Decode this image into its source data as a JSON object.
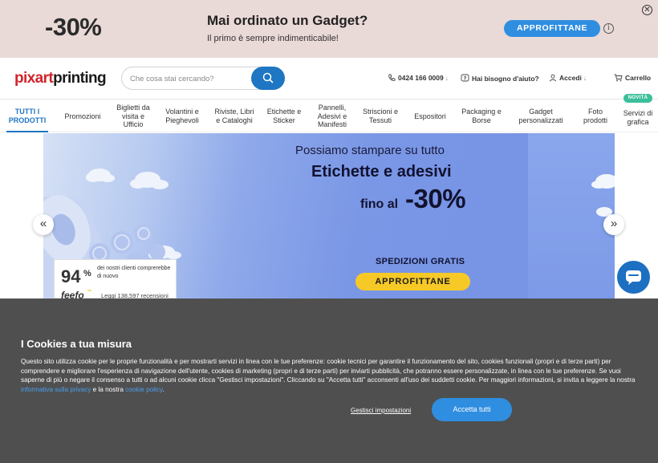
{
  "promo": {
    "discount": "-30%",
    "title": "Mai ordinato un Gadget?",
    "subtitle": "Il primo è sempre indimenticabile!",
    "cta": "APPROFITTANE",
    "info_icon": "info-icon",
    "close_icon": "close-icon"
  },
  "header": {
    "logo_red": "pixart",
    "logo_dark": "printing",
    "search_placeholder": "Che cosa stai cercando?",
    "phone": "0424 166 0009",
    "help": "Hai bisogno d'aiuto?",
    "login": "Accedi",
    "cart": "Carrello"
  },
  "nav": {
    "items": [
      {
        "label": "TUTTI I PRODOTTI"
      },
      {
        "label": "Promozioni"
      },
      {
        "label": "Biglietti da visita e Ufficio"
      },
      {
        "label": "Volantini e Pieghevoli"
      },
      {
        "label": "Riviste, Libri e Cataloghi"
      },
      {
        "label": "Etichette e Sticker"
      },
      {
        "label": "Pannelli, Adesivi e Manifesti"
      },
      {
        "label": "Striscioni e Tessuti"
      },
      {
        "label": "Espositori"
      },
      {
        "label": "Packaging e Borse"
      },
      {
        "label": "Gadget personalizzati"
      },
      {
        "label": "Foto prodotti"
      },
      {
        "label": "Servizi di grafica"
      }
    ],
    "new_badge": "NOVITÀ"
  },
  "hero": {
    "line1": "Possiamo stampare su tutto",
    "line2": "Etichette e adesivi",
    "line3_prefix": "fino al",
    "line3_discount": "-30%",
    "shipping": "SPEDIZIONI GRATIS",
    "cta": "APPROFITTANE"
  },
  "rating": {
    "percent": "94",
    "percent_sign": "%",
    "text": "dei nostri clienti comprerebbe di nuovo",
    "brand": "feefo",
    "brand_sup": "ᵉʳᵉ",
    "reviews": "Leggi 138,597 recensioni"
  },
  "cookie": {
    "title": "I Cookies a tua misura",
    "text_before": "Questo sito utilizza cookie per le proprie funzionalità e per mostrarti servizi in linea con le tue preferenze: cookie tecnici per garantire il funzionamento del sito, cookies funzionali (propri e di terze parti) per comprendere e migliorare l'esperienza di navigazione dell'utente, cookies di marketing (propri e di terze parti) per inviarti pubblicità, che potranno essere personalizzate, in linea con le tue preferenze. Se vuoi saperne di più o negare il consenso a tutti o ad alcuni cookie clicca \"Gestisci impostazioni\". Cliccando su \"Accetta tutti\" acconsenti all'uso dei suddetti cookie. Per maggiori informazioni, si invita a leggere la nostra ",
    "privacy_link": "informativa sulla privacy",
    "text_middle": " e la nostra ",
    "cookie_link": "cookie policy",
    "text_end": ".",
    "manage": "Gestisci impostazioni",
    "accept": "Accetta tutti"
  },
  "colors": {
    "promo_bg": "#e9d9d7",
    "brand_blue": "#1f76c2",
    "cta_blue": "#2f8ee0",
    "logo_red": "#d2232a",
    "hero_cta_yellow": "#f7c927",
    "cookie_bg": "#4f4f4f",
    "new_badge": "#3bbf9a"
  }
}
